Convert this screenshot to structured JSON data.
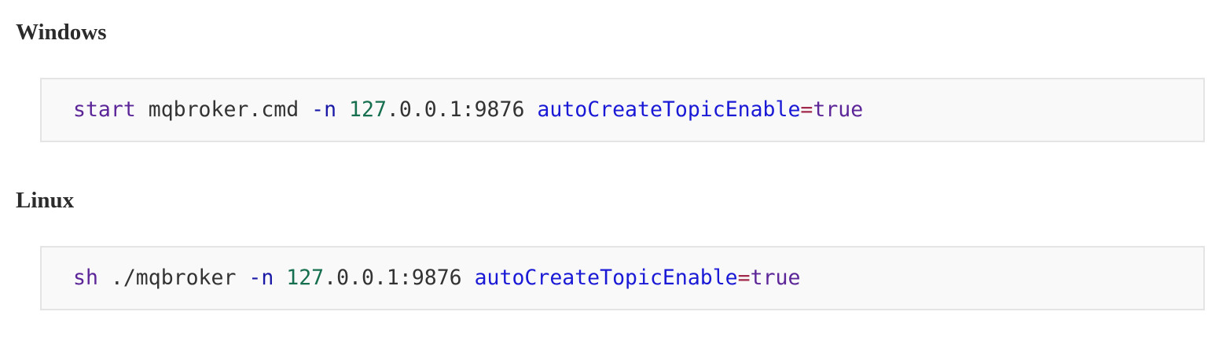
{
  "sections": [
    {
      "heading": "Windows",
      "code_tokens": [
        {
          "text": "start",
          "color": "#5c2699"
        },
        {
          "text": " mqbroker.cmd ",
          "color": "#333333"
        },
        {
          "text": "-n",
          "color": "#1a1aa6"
        },
        {
          "text": " ",
          "color": "#333333"
        },
        {
          "text": "127",
          "color": "#166f4f"
        },
        {
          "text": ".0.0.1:9876 ",
          "color": "#333333"
        },
        {
          "text": "autoCreateTopicEnable",
          "color": "#1a1ad6"
        },
        {
          "text": "=",
          "color": "#a0284a"
        },
        {
          "text": "true",
          "color": "#5c2699"
        }
      ]
    },
    {
      "heading": "Linux",
      "code_tokens": [
        {
          "text": "sh",
          "color": "#5c2699"
        },
        {
          "text": " ./mqbroker ",
          "color": "#333333"
        },
        {
          "text": "-n",
          "color": "#1a1aa6"
        },
        {
          "text": " ",
          "color": "#333333"
        },
        {
          "text": "127",
          "color": "#166f4f"
        },
        {
          "text": ".0.0.1:9876 ",
          "color": "#333333"
        },
        {
          "text": "autoCreateTopicEnable",
          "color": "#1a1ad6"
        },
        {
          "text": "=",
          "color": "#a0284a"
        },
        {
          "text": "true",
          "color": "#5c2699"
        }
      ]
    }
  ]
}
